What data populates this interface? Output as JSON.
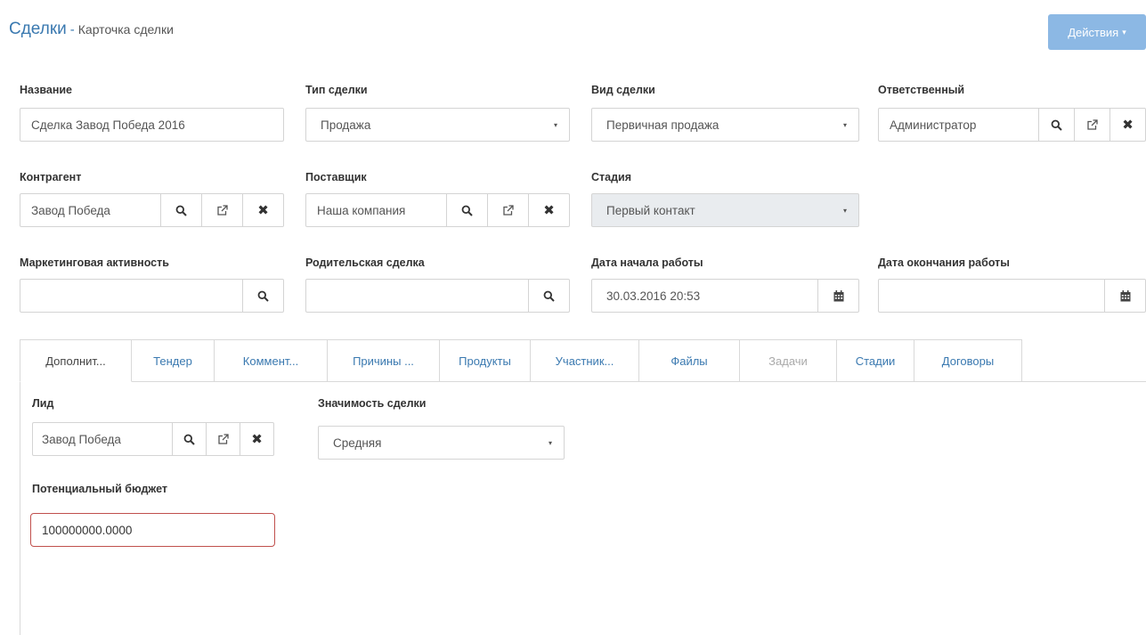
{
  "header": {
    "title": "Сделки",
    "separator": "-",
    "subtitle": "Карточка сделки"
  },
  "actions": {
    "label": "Действия",
    "caret": "▾"
  },
  "fields": {
    "name": {
      "label": "Название",
      "value": "Сделка Завод Победа 2016"
    },
    "deal_type": {
      "label": "Тип сделки",
      "value": "Продажа"
    },
    "deal_kind": {
      "label": "Вид сделки",
      "value": "Первичная продажа"
    },
    "responsible": {
      "label": "Ответственный",
      "value": "Администратор"
    },
    "counterparty": {
      "label": "Контрагент",
      "value": "Завод Победа"
    },
    "supplier": {
      "label": "Поставщик",
      "value": "Наша компания"
    },
    "stage": {
      "label": "Стадия",
      "value": "Первый контакт"
    },
    "marketing": {
      "label": "Маркетинговая активность",
      "value": ""
    },
    "parent_deal": {
      "label": "Родительская сделка",
      "value": ""
    },
    "start_date": {
      "label": "Дата начала работы",
      "value": "30.03.2016 20:53"
    },
    "end_date": {
      "label": "Дата окончания работы",
      "value": ""
    }
  },
  "tabs": [
    {
      "label": "Дополнит..."
    },
    {
      "label": "Тендер"
    },
    {
      "label": "Коммент..."
    },
    {
      "label": "Причины ..."
    },
    {
      "label": "Продукты"
    },
    {
      "label": "Участник..."
    },
    {
      "label": "Файлы"
    },
    {
      "label": "Задачи"
    },
    {
      "label": "Стадии"
    },
    {
      "label": "Договоры"
    }
  ],
  "panel": {
    "lead": {
      "label": "Лид",
      "value": "Завод Победа"
    },
    "significance": {
      "label": "Значимость сделки",
      "value": "Средняя"
    },
    "budget": {
      "label": "Потенциальный бюджет",
      "value": "100000000.0000"
    }
  },
  "icons": {
    "select_arrow": "▾",
    "clear": "✖"
  },
  "colors": {
    "link": "#3a79b0",
    "actions_button": "#8cb8e4",
    "error_border": "#c0504d",
    "disabled_bg": "#e9ecef"
  }
}
